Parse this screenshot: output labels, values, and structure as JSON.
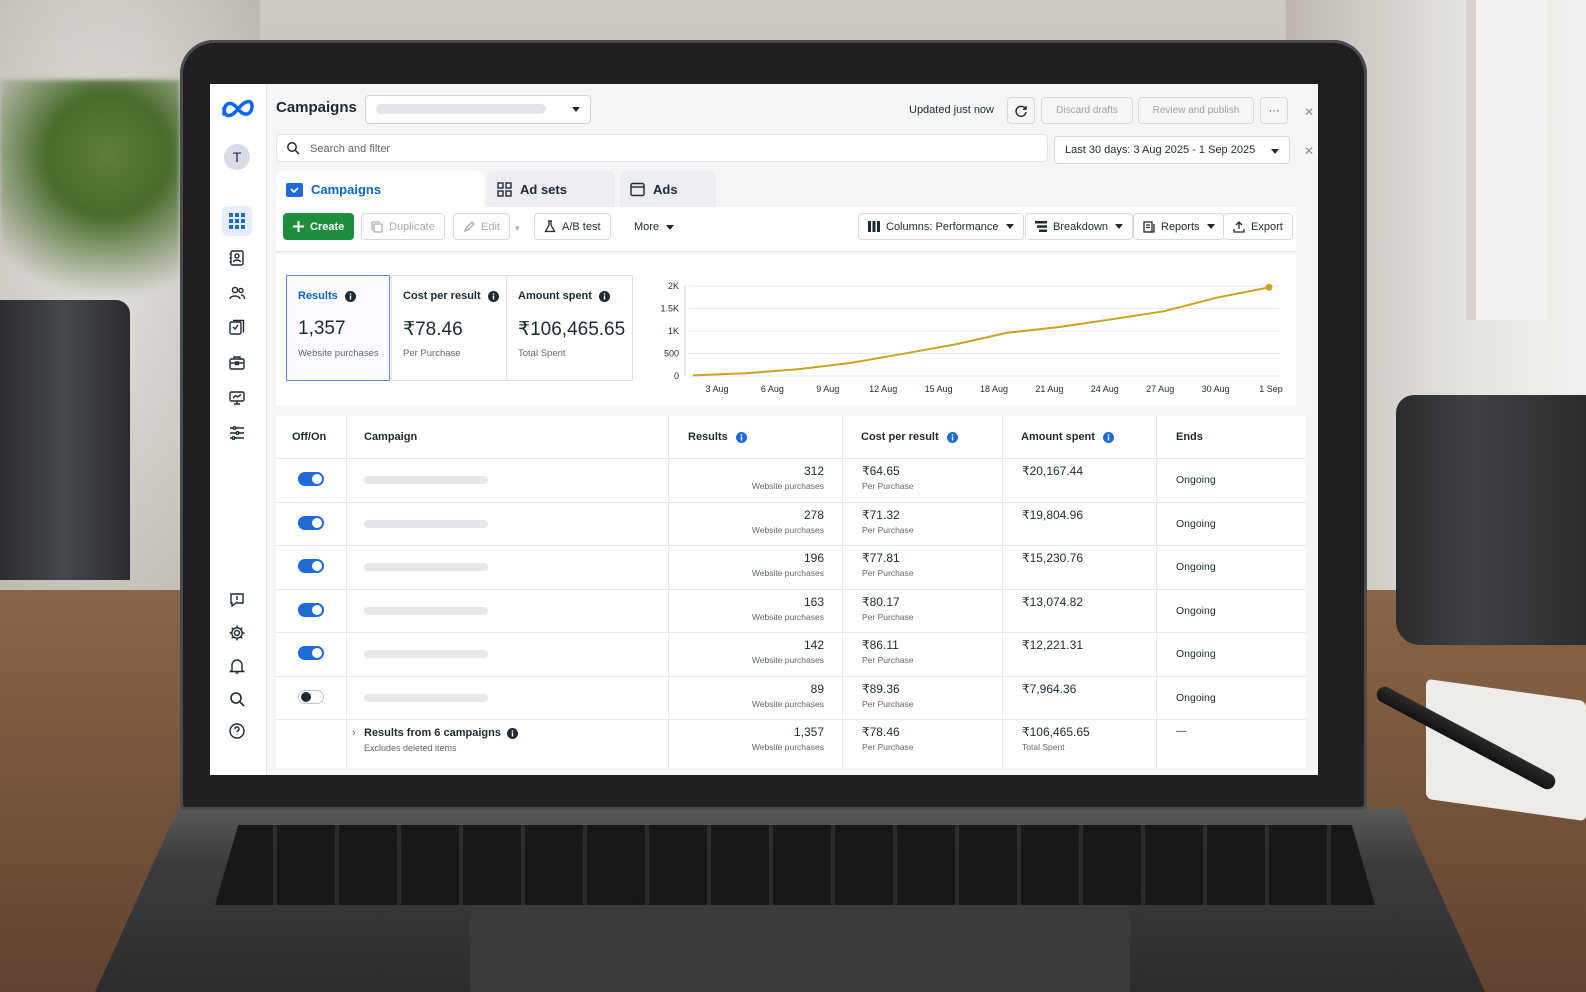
{
  "header": {
    "title": "Campaigns",
    "updated": "Updated just now",
    "discard": "Discard drafts",
    "review": "Review and publish",
    "more": "···"
  },
  "avatar": "T",
  "search": {
    "placeholder": "Search and filter"
  },
  "date_range": "Last 30 days: 3 Aug 2025 - 1 Sep 2025",
  "tabs": [
    {
      "label": "Campaigns"
    },
    {
      "label": "Ad sets"
    },
    {
      "label": "Ads"
    }
  ],
  "toolbar": {
    "create": "Create",
    "duplicate": "Duplicate",
    "edit": "Edit",
    "ab_test": "A/B test",
    "more": "More",
    "columns": "Columns: Performance",
    "breakdown": "Breakdown",
    "reports": "Reports",
    "export": "Export"
  },
  "metrics": [
    {
      "label": "Results",
      "value": "1,357",
      "sub": "Website purchases"
    },
    {
      "label": "Cost per result",
      "value": "₹78.46",
      "sub": "Per Purchase"
    },
    {
      "label": "Amount spent",
      "value": "₹106,465.65",
      "sub": "Total Spent"
    }
  ],
  "chart_data": {
    "type": "line",
    "x": [
      "3 Aug",
      "6 Aug",
      "9 Aug",
      "12 Aug",
      "15 Aug",
      "18 Aug",
      "21 Aug",
      "24 Aug",
      "27 Aug",
      "30 Aug",
      "1 Sep"
    ],
    "series": [
      {
        "values": [
          15,
          60,
          150,
          290,
          490,
          700,
          960,
          1090,
          1260,
          1440,
          1740,
          1970
        ]
      }
    ],
    "ylim": [
      0,
      2000
    ],
    "yticks": [
      "0",
      "500",
      "1K",
      "1.5K",
      "2K"
    ],
    "line_color": "#c9a227",
    "grid": true
  },
  "table": {
    "headers": {
      "toggle": "Off/On",
      "campaign": "Campaign",
      "results": "Results",
      "cost": "Cost per result",
      "amount": "Amount spent",
      "ends": "Ends"
    },
    "rows": [
      {
        "on": true,
        "results": "312",
        "results_sub": "Website purchases",
        "cost": "₹64.65",
        "cost_sub": "Per Purchase",
        "amount": "₹20,167.44",
        "ends": "Ongoing"
      },
      {
        "on": true,
        "results": "278",
        "results_sub": "Website purchases",
        "cost": "₹71.32",
        "cost_sub": "Per Purchase",
        "amount": "₹19,804.96",
        "ends": "Ongoing"
      },
      {
        "on": true,
        "results": "196",
        "results_sub": "Website purchases",
        "cost": "₹77.81",
        "cost_sub": "Per Purchase",
        "amount": "₹15,230.76",
        "ends": "Ongoing"
      },
      {
        "on": true,
        "results": "163",
        "results_sub": "Website purchases",
        "cost": "₹80.17",
        "cost_sub": "Per Purchase",
        "amount": "₹13,074.82",
        "ends": "Ongoing"
      },
      {
        "on": true,
        "results": "142",
        "results_sub": "Website purchases",
        "cost": "₹86.11",
        "cost_sub": "Per Purchase",
        "amount": "₹12,221.31",
        "ends": "Ongoing"
      },
      {
        "on": false,
        "results": "89",
        "results_sub": "Website purchases",
        "cost": "₹89.36",
        "cost_sub": "Per Purchase",
        "amount": "₹7,964.36",
        "ends": "Ongoing"
      }
    ],
    "summary": {
      "label": "Results from 6 campaigns",
      "sub": "Excludes deleted items",
      "results": "1,357",
      "results_sub": "Website purchases",
      "cost": "₹78.46",
      "cost_sub": "Per Purchase",
      "amount": "₹106,465.65",
      "amount_sub": "Total Spent",
      "ends": "—"
    }
  },
  "icons": {
    "rail": [
      "grid-icon",
      "contacts-icon",
      "audience-icon",
      "pages-icon",
      "briefcase-icon",
      "monitor-icon",
      "list-icon",
      "feedback-icon",
      "gear-icon",
      "bell-icon",
      "search-icon",
      "help-icon"
    ]
  },
  "colors": {
    "accent": "#0a66c2",
    "create": "#1e8e3e",
    "toggle_on": "#1f6bd6",
    "chart_line": "#c9a227"
  }
}
